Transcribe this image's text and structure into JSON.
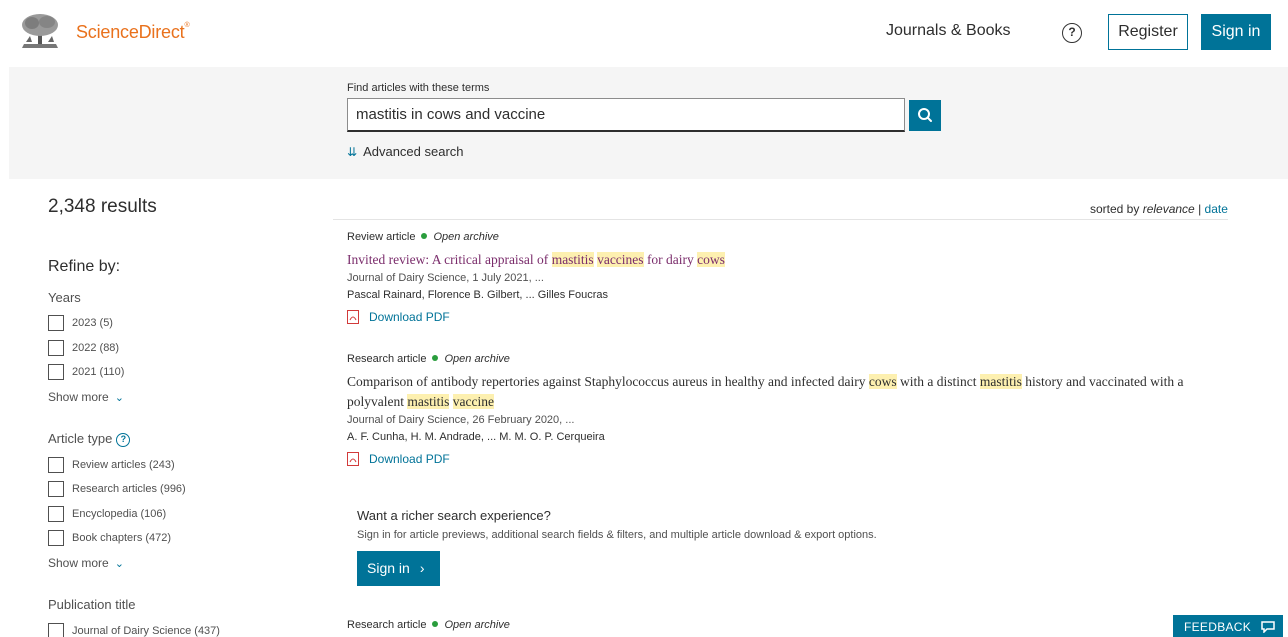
{
  "header": {
    "brand": "ScienceDirect",
    "brand_mark": "®",
    "nav_journals": "Journals & Books",
    "help": "?",
    "register": "Register",
    "sign_in": "Sign in"
  },
  "search": {
    "label": "Find articles with these terms",
    "value": "mastitis in cows and vaccine",
    "advanced": "Advanced search"
  },
  "results": {
    "count": "2,348 results",
    "sorted_prefix": "sorted by",
    "sorted_relevance": "relevance",
    "sorted_sep": "|",
    "sorted_date": "date"
  },
  "sidebar": {
    "refine_by": "Refine by:",
    "years_title": "Years",
    "years": [
      "2023 (5)",
      "2022 (88)",
      "2021 (110)"
    ],
    "show_more": "Show more",
    "article_type_title": "Article type",
    "info": "?",
    "article_types": [
      "Review articles (243)",
      "Research articles (996)",
      "Encyclopedia (106)",
      "Book chapters (472)"
    ],
    "publication_title": "Publication title",
    "publications": [
      "Journal of Dairy Science (437)"
    ]
  },
  "items": [
    {
      "type": "Review article",
      "access": "Open archive",
      "title_parts": [
        "Invited review: A critical appraisal of ",
        "mastitis",
        " ",
        "vaccines",
        " for dairy ",
        "cows"
      ],
      "source": "Journal of Dairy Science, 1 July 2021, ...",
      "authors": "Pascal Rainard, Florence B. Gilbert, ... Gilles Foucras",
      "pdf": "Download PDF"
    },
    {
      "type": "Research article",
      "access": "Open archive",
      "title_parts": [
        "Comparison of antibody repertories against Staphylococcus aureus in healthy and infected dairy ",
        "cows",
        " with a distinct ",
        "mastitis",
        " history and vaccinated with a polyvalent ",
        "mastitis",
        " ",
        "vaccine"
      ],
      "source": "Journal of Dairy Science, 26 February 2020, ...",
      "authors": "A. F. Cunha, H. M. Andrade, ... M. M. O. P. Cerqueira",
      "pdf": "Download PDF"
    },
    {
      "type": "Research article",
      "access": "Open archive"
    }
  ],
  "promo": {
    "title": "Want a richer search experience?",
    "text": "Sign in for article previews, additional search fields & filters, and multiple article download & export options.",
    "button": "Sign in",
    "arrow": "›"
  },
  "feedback": "FEEDBACK",
  "colors": {
    "accent": "#007398",
    "brand": "#e9711c",
    "highlight": "#fdf0b0",
    "visited_link": "#7a2c6b",
    "open_dot": "#2a9d3d"
  }
}
